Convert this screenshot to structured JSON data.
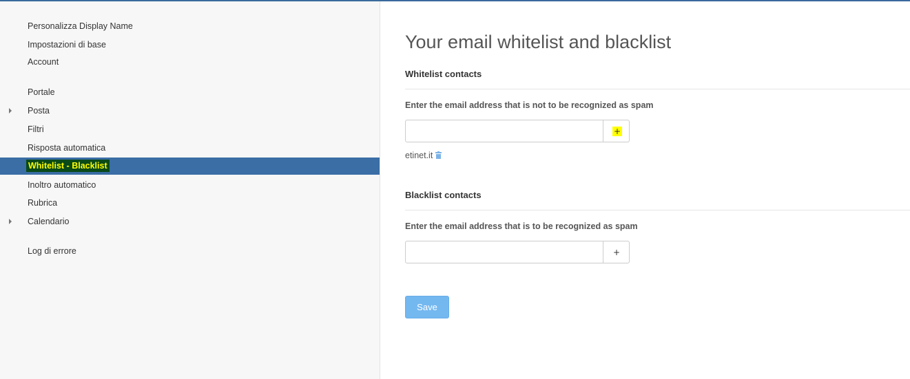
{
  "sidebar": {
    "items": [
      {
        "label": "Personalizza Display Name"
      },
      {
        "label": "Impostazioni di base"
      },
      {
        "label": "Account"
      },
      {
        "label": "Portale"
      },
      {
        "label": "Posta"
      },
      {
        "label": "Filtri"
      },
      {
        "label": "Risposta automatica"
      },
      {
        "label": "Whitelist - Blacklist"
      },
      {
        "label": "Inoltro automatico"
      },
      {
        "label": "Rubrica"
      },
      {
        "label": "Calendario"
      },
      {
        "label": "Log di errore"
      }
    ],
    "active_item": "Whitelist - Blacklist"
  },
  "main": {
    "title": "Your email whitelist and blacklist",
    "whitelist": {
      "heading": "Whitelist contacts",
      "prompt": "Enter the email address that is not to be recognized as spam",
      "input_value": "",
      "add_label": "+",
      "entries": [
        "etinet.it"
      ]
    },
    "blacklist": {
      "heading": "Blacklist contacts",
      "prompt": "Enter the email address that is to be recognized as spam",
      "input_value": "",
      "add_label": "+"
    },
    "save_label": "Save"
  },
  "colors": {
    "accent": "#3a6ea5",
    "highlight": "#ffff00",
    "save_button": "#74b8f0",
    "trash_icon": "#7bb3e6"
  },
  "icons": {
    "expand": "caret-right-icon",
    "delete": "trash-icon"
  }
}
